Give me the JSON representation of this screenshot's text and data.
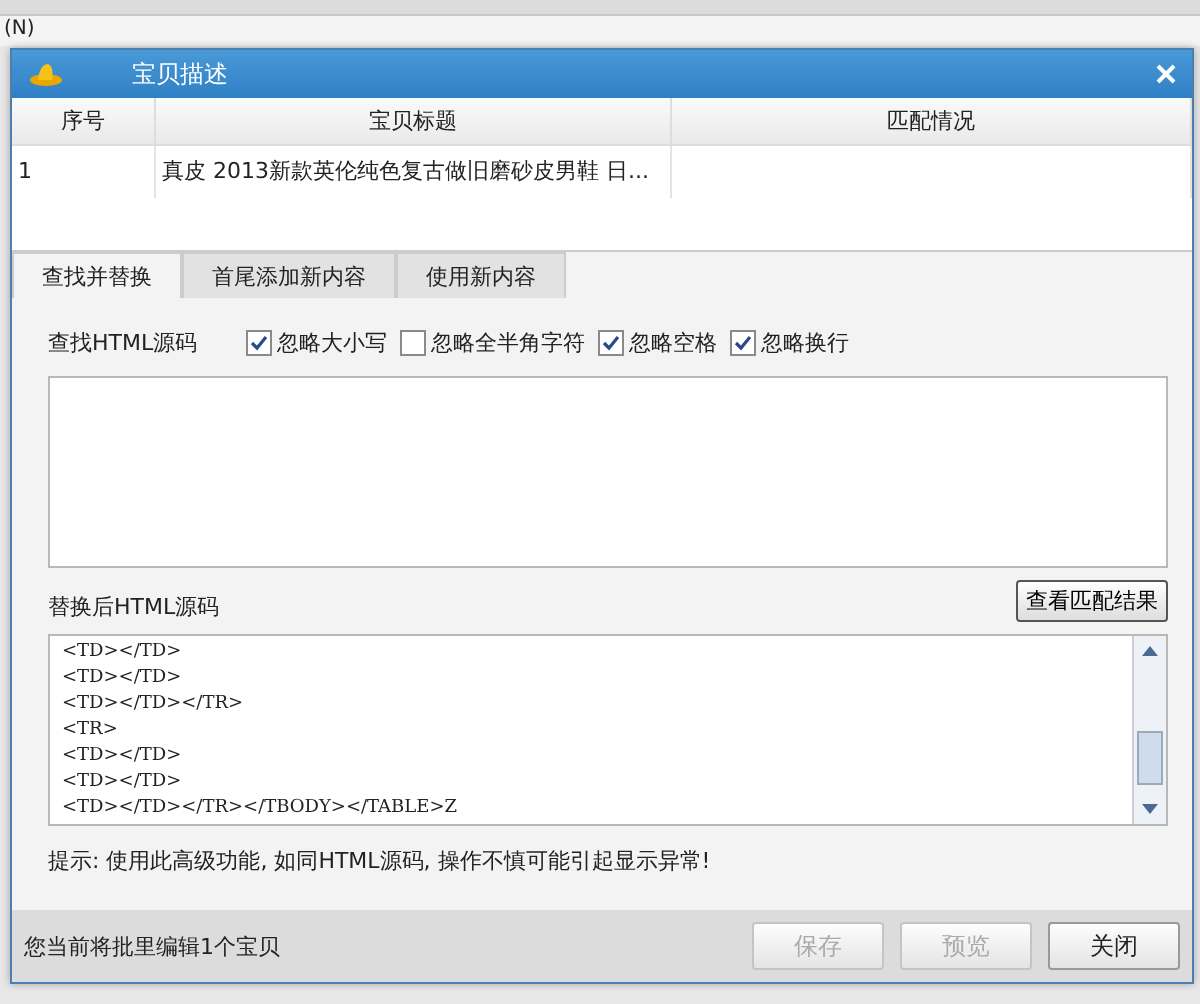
{
  "background": {
    "menu_item": "(N)"
  },
  "window": {
    "title": "宝贝描述"
  },
  "table": {
    "columns": [
      "序号",
      "宝贝标题",
      "匹配情况"
    ],
    "rows": [
      [
        "1",
        "真皮 2013新款英伦纯色复古做旧磨砂皮男鞋 日...",
        ""
      ]
    ]
  },
  "tabs": [
    {
      "label": "查找并替换",
      "selected": true
    },
    {
      "label": "首尾添加新内容",
      "selected": false
    },
    {
      "label": "使用新内容",
      "selected": false
    }
  ],
  "find": {
    "label": "查找HTML源码",
    "options": [
      {
        "label": "忽略大小写",
        "checked": true
      },
      {
        "label": "忽略全半角字符",
        "checked": false
      },
      {
        "label": "忽略空格",
        "checked": true
      },
      {
        "label": "忽略换行",
        "checked": true
      }
    ]
  },
  "replace": {
    "label": "替换后HTML源码",
    "button": "查看匹配结果",
    "lines": [
      "<TD></TD>",
      "<TD></TD>",
      "<TD></TD></TR>",
      "<TR>",
      "<TD></TD>",
      "<TD></TD>",
      "<TD></TD></TR></TBODY></TABLE>Z"
    ]
  },
  "hint": "提示: 使用此高级功能, 如同HTML源码, 操作不慎可能引起显示异常!",
  "status": "您当前将批里编辑1个宝贝",
  "buttons": [
    {
      "label": "保存",
      "disabled": true
    },
    {
      "label": "预览",
      "disabled": true
    },
    {
      "label": "关闭",
      "disabled": false
    }
  ]
}
